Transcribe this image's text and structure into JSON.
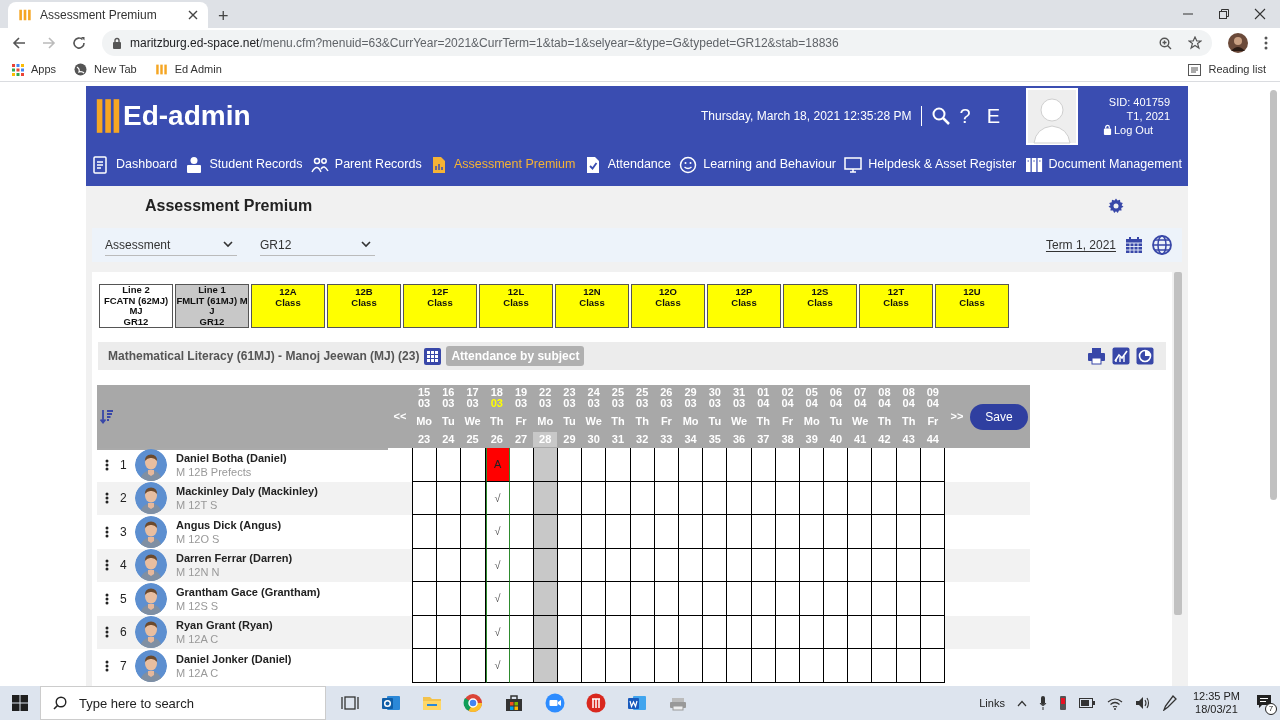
{
  "browser": {
    "tab_title": "Assessment Premium",
    "new_tab": "+",
    "url_host": "maritzburg.ed-space.net",
    "url_path": "/menu.cfm?menuid=63&CurrYear=2021&CurrTerm=1&tab=1&selyear=&type=G&typedet=GR12&stab=18836",
    "bookmarks": [
      "Apps",
      "New Tab",
      "Ed Admin"
    ],
    "reading_list": "Reading list"
  },
  "header": {
    "logo": "Ed-admin",
    "datetime": "Thursday, March 18, 2021 12:35:28 PM",
    "help": "?",
    "e_button": "E",
    "sid": "SID: 401759",
    "term": "T1, 2021",
    "logout": "Log Out"
  },
  "nav": [
    {
      "label": "Dashboard",
      "selected": false
    },
    {
      "label": "Student Records",
      "selected": false
    },
    {
      "label": "Parent Records",
      "selected": false
    },
    {
      "label": "Assessment Premium",
      "selected": true
    },
    {
      "label": "Attendance",
      "selected": false
    },
    {
      "label": "Learning and Behaviour",
      "selected": false
    },
    {
      "label": "Helpdesk & Asset Register",
      "selected": false
    },
    {
      "label": "Document Management",
      "selected": false
    }
  ],
  "page": {
    "title": "Assessment Premium",
    "filters": [
      "Assessment",
      "GR12"
    ],
    "term": "Term 1, 2021"
  },
  "classes": [
    {
      "kind": "line",
      "selected": false,
      "lines": [
        "Line 2",
        "FCATN (62MJ)",
        "MJ",
        "GR12"
      ]
    },
    {
      "kind": "line",
      "selected": true,
      "lines": [
        "Line 1",
        "FMLIT (61MJ) M",
        "J",
        "GR12"
      ]
    },
    {
      "kind": "class",
      "selected": false,
      "lines": [
        "12A",
        "Class"
      ]
    },
    {
      "kind": "class",
      "selected": false,
      "lines": [
        "12B",
        "Class"
      ]
    },
    {
      "kind": "class",
      "selected": false,
      "lines": [
        "12F",
        "Class"
      ]
    },
    {
      "kind": "class",
      "selected": false,
      "lines": [
        "12L",
        "Class"
      ]
    },
    {
      "kind": "class",
      "selected": false,
      "lines": [
        "12N",
        "Class"
      ]
    },
    {
      "kind": "class",
      "selected": false,
      "lines": [
        "12O",
        "Class"
      ]
    },
    {
      "kind": "class",
      "selected": false,
      "lines": [
        "12P",
        "Class"
      ]
    },
    {
      "kind": "class",
      "selected": false,
      "lines": [
        "12S",
        "Class"
      ]
    },
    {
      "kind": "class",
      "selected": false,
      "lines": [
        "12T",
        "Class"
      ]
    },
    {
      "kind": "class",
      "selected": false,
      "lines": [
        "12U",
        "Class"
      ]
    }
  ],
  "subject": {
    "title": "Mathematical Literacy (61MJ) - Manoj Jeewan (MJ) (23)",
    "badge": "Attendance by subject"
  },
  "attendance": {
    "prev": "<<",
    "next": ">>",
    "save": "Save",
    "columns": [
      {
        "day": "15",
        "month": "03",
        "weekday": "Mo",
        "number": "23",
        "today": false,
        "shaded": false
      },
      {
        "day": "16",
        "month": "03",
        "weekday": "Tu",
        "number": "24",
        "today": false,
        "shaded": false
      },
      {
        "day": "17",
        "month": "03",
        "weekday": "We",
        "number": "25",
        "today": false,
        "shaded": false
      },
      {
        "day": "18",
        "month": "03",
        "weekday": "Th",
        "number": "26",
        "today": true,
        "shaded": false,
        "entries": [
          {
            "text": "A",
            "kind": "absent"
          },
          {
            "text": "√",
            "kind": "present"
          },
          {
            "text": "√",
            "kind": "present"
          },
          {
            "text": "√",
            "kind": "present"
          },
          {
            "text": "√",
            "kind": "present"
          },
          {
            "text": "√",
            "kind": "present"
          },
          {
            "text": "√",
            "kind": "present"
          }
        ]
      },
      {
        "day": "19",
        "month": "03",
        "weekday": "Fr",
        "number": "27",
        "today": false,
        "shaded": false
      },
      {
        "day": "22",
        "month": "03",
        "weekday": "Mo",
        "number": "28",
        "today": false,
        "shaded": true
      },
      {
        "day": "23",
        "month": "03",
        "weekday": "Tu",
        "number": "29",
        "today": false,
        "shaded": false
      },
      {
        "day": "24",
        "month": "03",
        "weekday": "We",
        "number": "30",
        "today": false,
        "shaded": false
      },
      {
        "day": "25",
        "month": "03",
        "weekday": "Th",
        "number": "31",
        "today": false,
        "shaded": false
      },
      {
        "day": "25",
        "month": "03",
        "weekday": "Th",
        "number": "32",
        "today": false,
        "shaded": false
      },
      {
        "day": "26",
        "month": "03",
        "weekday": "Fr",
        "number": "33",
        "today": false,
        "shaded": false
      },
      {
        "day": "29",
        "month": "03",
        "weekday": "Mo",
        "number": "34",
        "today": false,
        "shaded": false
      },
      {
        "day": "30",
        "month": "03",
        "weekday": "Tu",
        "number": "35",
        "today": false,
        "shaded": false
      },
      {
        "day": "31",
        "month": "03",
        "weekday": "We",
        "number": "36",
        "today": false,
        "shaded": false
      },
      {
        "day": "01",
        "month": "04",
        "weekday": "Th",
        "number": "37",
        "today": false,
        "shaded": false
      },
      {
        "day": "02",
        "month": "04",
        "weekday": "Fr",
        "number": "38",
        "today": false,
        "shaded": false
      },
      {
        "day": "05",
        "month": "04",
        "weekday": "Mo",
        "number": "39",
        "today": false,
        "shaded": false
      },
      {
        "day": "06",
        "month": "04",
        "weekday": "Tu",
        "number": "40",
        "today": false,
        "shaded": false
      },
      {
        "day": "07",
        "month": "04",
        "weekday": "We",
        "number": "41",
        "today": false,
        "shaded": false
      },
      {
        "day": "08",
        "month": "04",
        "weekday": "Th",
        "number": "42",
        "today": false,
        "shaded": false
      },
      {
        "day": "08",
        "month": "04",
        "weekday": "Th",
        "number": "43",
        "today": false,
        "shaded": false
      },
      {
        "day": "09",
        "month": "04",
        "weekday": "Fr",
        "number": "44",
        "today": false,
        "shaded": false
      }
    ],
    "students": [
      {
        "number": "1",
        "name": "Daniel Botha (Daniel)",
        "detail": "M 12B Prefects"
      },
      {
        "number": "2",
        "name": "Mackinley Daly (Mackinley)",
        "detail": "M 12T S"
      },
      {
        "number": "3",
        "name": "Angus Dick (Angus)",
        "detail": "M 12O S"
      },
      {
        "number": "4",
        "name": "Darren Ferrar (Darren)",
        "detail": "M 12N N"
      },
      {
        "number": "5",
        "name": "Grantham Gace (Grantham)",
        "detail": "M 12S S"
      },
      {
        "number": "6",
        "name": "Ryan Grant (Ryan)",
        "detail": "M 12A C"
      },
      {
        "number": "7",
        "name": "Daniel Jonker (Daniel)",
        "detail": "M 12A C"
      }
    ]
  },
  "taskbar": {
    "search_placeholder": "Type here to search",
    "links": "Links",
    "time": "12:35 PM",
    "date": "18/03/21",
    "notifications": "7"
  }
}
